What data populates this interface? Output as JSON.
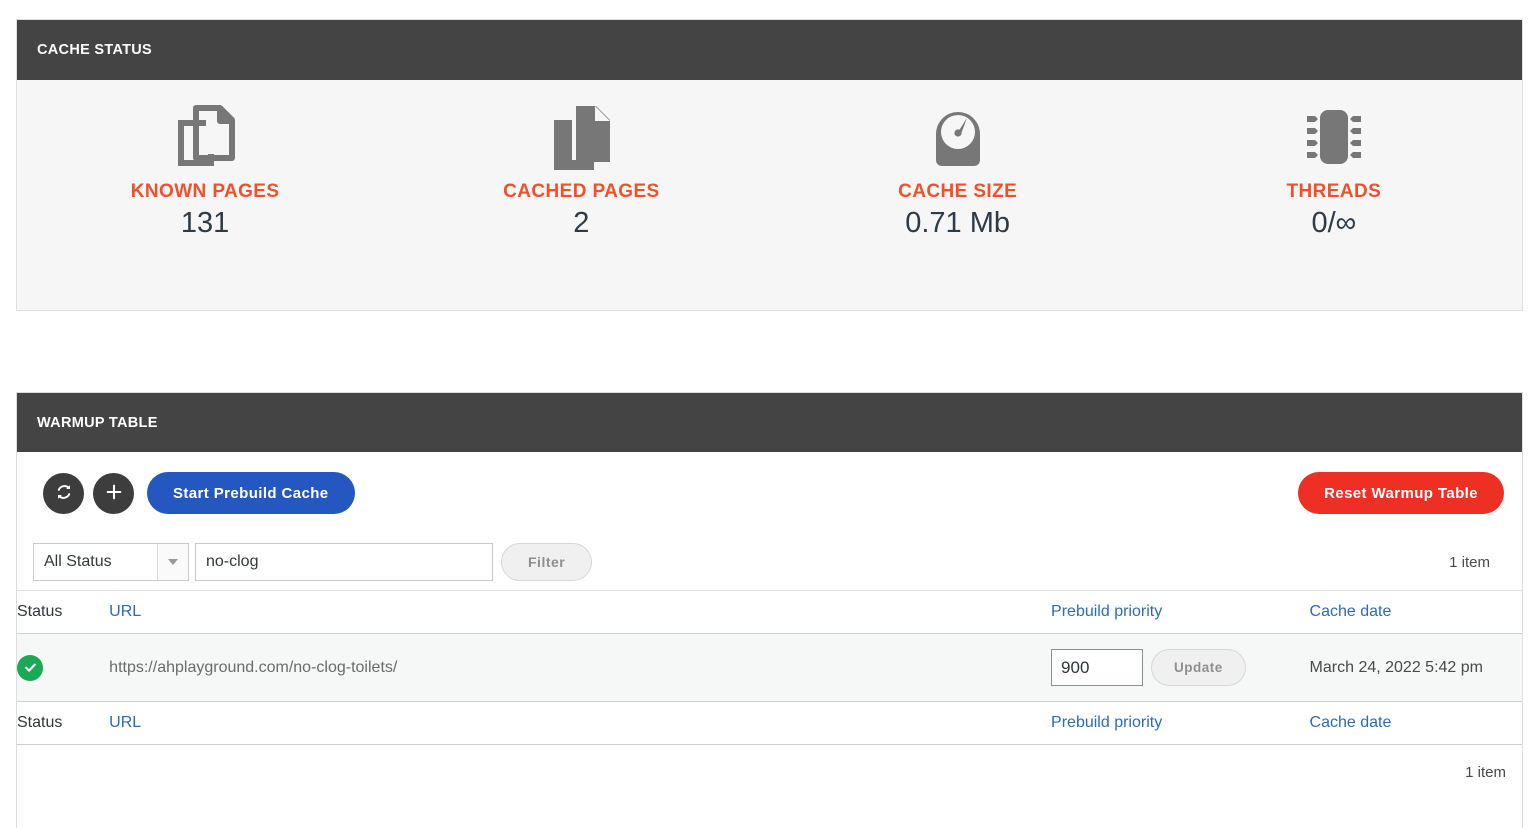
{
  "cache_status": {
    "title": "CACHE STATUS",
    "accent_color": "#f0512b",
    "stats": [
      {
        "icon": "copy-outline-icon",
        "label": "KNOWN PAGES",
        "value": "131"
      },
      {
        "icon": "copy-filled-icon",
        "label": "CACHED PAGES",
        "value": "2"
      },
      {
        "icon": "gauge-icon",
        "label": "CACHE SIZE",
        "value": "0.71 Mb"
      },
      {
        "icon": "cpu-chip-icon",
        "label": "THREADS",
        "value": "0/∞"
      }
    ]
  },
  "warmup": {
    "title": "WARMUP TABLE",
    "toolbar": {
      "refresh_icon": "refresh-icon",
      "add_icon": "plus-icon",
      "start_prebuild_label": "Start Prebuild Cache",
      "start_prebuild_color": "#2458c0",
      "reset_label": "Reset Warmup Table",
      "reset_color": "#ee2f23"
    },
    "filter": {
      "status_select_value": "All Status",
      "search_value": "no-clog",
      "search_placeholder": "",
      "filter_button_label": "Filter",
      "item_count_top": "1 item",
      "item_count_bottom": "1 item"
    },
    "columns": {
      "status": "Status",
      "url": "URL",
      "prebuild_priority": "Prebuild priority",
      "cache_date": "Cache date"
    },
    "rows": [
      {
        "status_icon": "check-circle-icon",
        "status_color": "#1aaa55",
        "url": "https://ahplayground.com/no-clog-toilets/",
        "priority": "900",
        "update_label": "Update",
        "cache_date": "March 24, 2022 5:42 pm"
      }
    ]
  }
}
